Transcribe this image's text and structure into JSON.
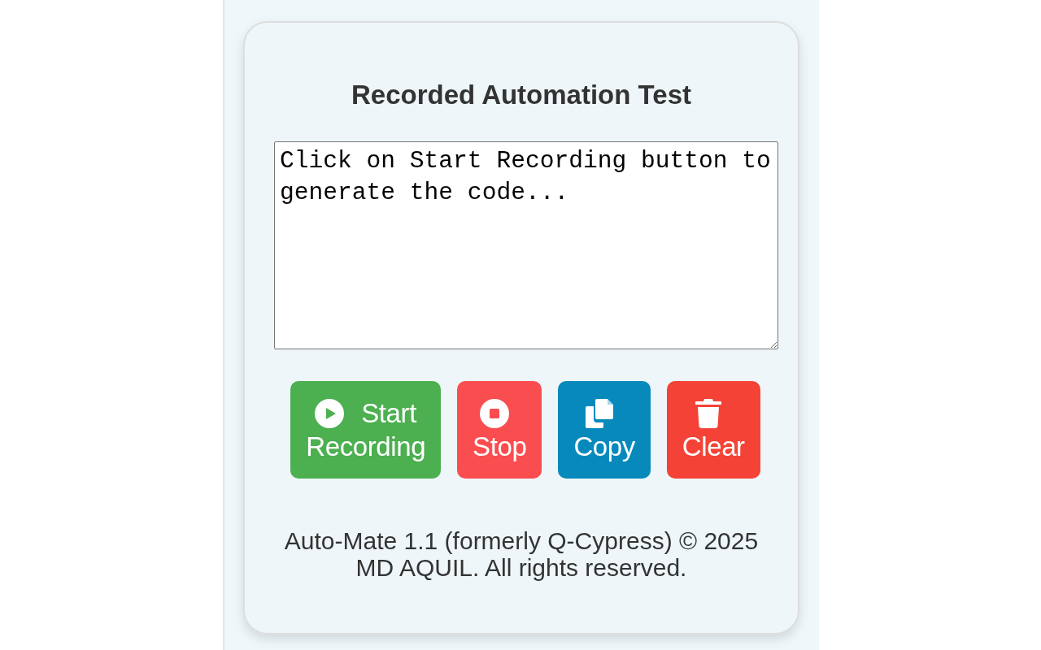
{
  "title": "Recorded Automation Test",
  "code_box": {
    "value": "Click on Start Recording button to generate the code..."
  },
  "buttons": [
    {
      "kind": "start",
      "label": "Start Recording"
    },
    {
      "kind": "stop",
      "label": "Stop"
    },
    {
      "kind": "copy",
      "label": "Copy"
    },
    {
      "kind": "clear",
      "label": "Clear"
    }
  ],
  "footer": "Auto-Mate 1.1 (formerly Q-Cypress) © 2025 MD AQUIL. All rights reserved."
}
